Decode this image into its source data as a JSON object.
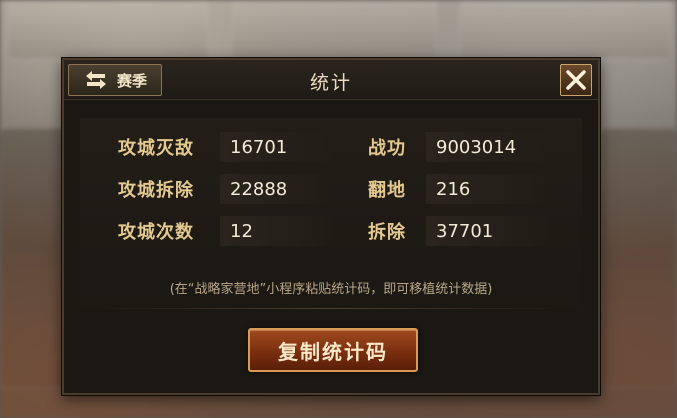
{
  "dialog": {
    "title": "统计",
    "season_button": "赛季",
    "season_icon": "swap-arrows-icon",
    "close_icon": "close-x-icon"
  },
  "stats_left": [
    {
      "label": "攻城灭敌",
      "value": "16701"
    },
    {
      "label": "攻城拆除",
      "value": "22888"
    },
    {
      "label": "攻城次数",
      "value": "12"
    }
  ],
  "stats_right": [
    {
      "label": "战功",
      "value": "9003014"
    },
    {
      "label": "翻地",
      "value": "216"
    },
    {
      "label": "拆除",
      "value": "37701"
    }
  ],
  "hint": "(在“战略家营地”小程序粘贴统计码，即可移植统计数据)",
  "copy_button": "复制统计码",
  "colors": {
    "panel_bg": "#1b1712",
    "label_gold": "#e3c98f",
    "button_red": "#8a3a16",
    "button_border": "#d79b55"
  }
}
